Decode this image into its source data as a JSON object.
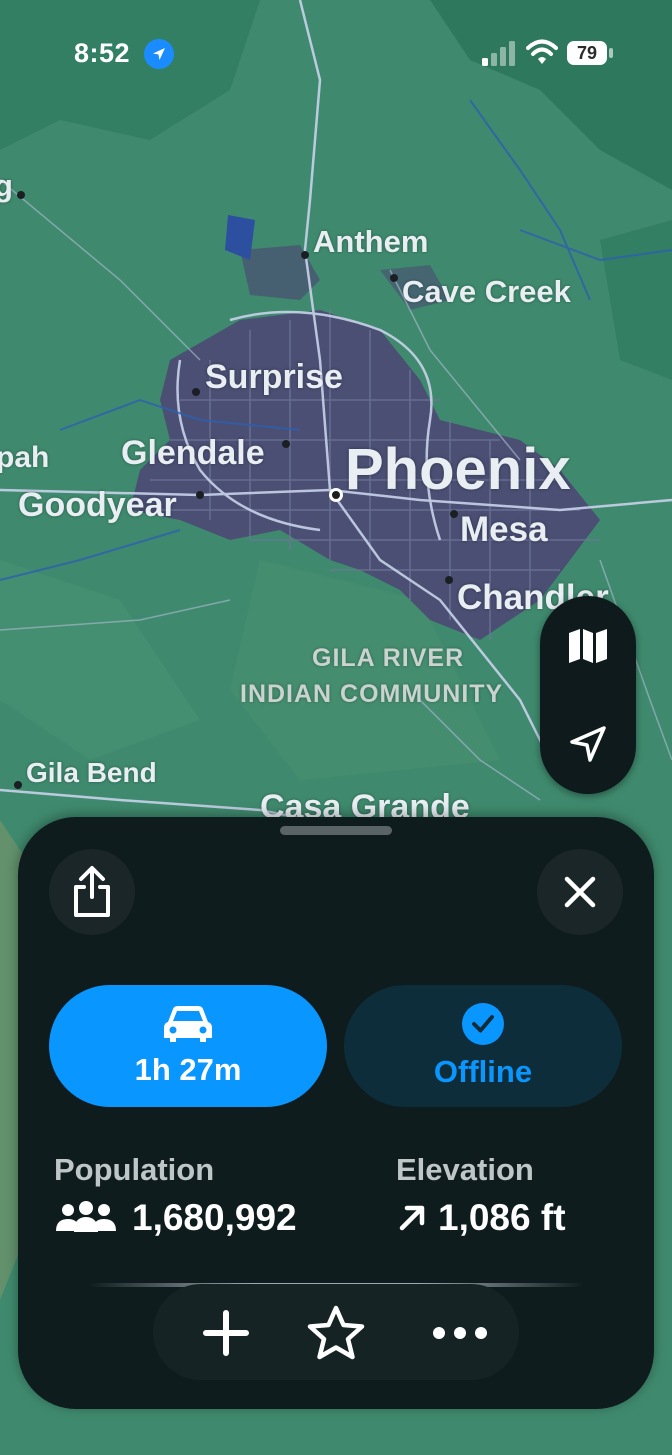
{
  "status_bar": {
    "time": "8:52",
    "battery": "79"
  },
  "map": {
    "places": [
      {
        "name": "Anthem",
        "size": "medium"
      },
      {
        "name": "Cave Creek",
        "size": "medium"
      },
      {
        "name": "Surprise",
        "size": "medium"
      },
      {
        "name": "Glendale",
        "size": "medium"
      },
      {
        "name": "Phoenix",
        "size": "large"
      },
      {
        "name": "Goodyear",
        "size": "medium"
      },
      {
        "name": "Mesa",
        "size": "medium"
      },
      {
        "name": "Chandler",
        "size": "medium"
      },
      {
        "name": "Gila Bend",
        "size": "small"
      },
      {
        "name": "Casa Grande",
        "size": "medium"
      }
    ],
    "edge_labels": [
      "g",
      "pah"
    ],
    "region_line1": "GILA RIVER",
    "region_line2": "INDIAN COMMUNITY"
  },
  "map_controls": {
    "map_style_icon": "map-icon",
    "locate_icon": "location-arrow-icon"
  },
  "sheet": {
    "share_icon": "share-icon",
    "close_icon": "close-icon",
    "drive": {
      "icon": "car-icon",
      "label": "1h 27m"
    },
    "offline": {
      "icon": "checkmark-circle-icon",
      "label": "Offline"
    },
    "population": {
      "title": "Population",
      "value": "1,680,992",
      "icon": "people-icon"
    },
    "elevation": {
      "title": "Elevation",
      "value": "1,086 ft",
      "icon": "arrow-up-right-icon"
    },
    "toolbar": {
      "add_icon": "plus-icon",
      "favorite_icon": "star-icon",
      "more_icon": "ellipsis-icon"
    }
  },
  "colors": {
    "accent": "#0a96ff",
    "sheet_bg": "#0f1c1e",
    "map_green": "#3f8a6e",
    "urban": "#4a4f73"
  }
}
